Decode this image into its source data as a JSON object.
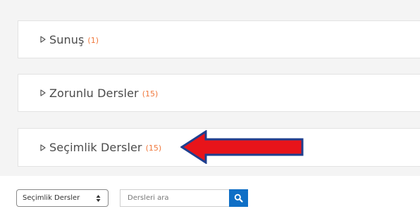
{
  "categories": [
    {
      "name": "Sunuş",
      "count": "(1)"
    },
    {
      "name": "Zorunlu Dersler",
      "count": "(15)"
    },
    {
      "name": "Seçimlik Dersler",
      "count": "(15)"
    }
  ],
  "filter": {
    "select_value": "Seçimlik Dersler",
    "search_placeholder": "Dersleri ara",
    "search_icon": "search-icon"
  },
  "icons": {
    "expand": "triangle-right-icon",
    "annotation": "red-arrow-left"
  },
  "colors": {
    "count": "#f0783c",
    "search_button": "#0f6fc6",
    "arrow_fill": "#e8141a",
    "arrow_stroke": "#1f3f8f"
  }
}
